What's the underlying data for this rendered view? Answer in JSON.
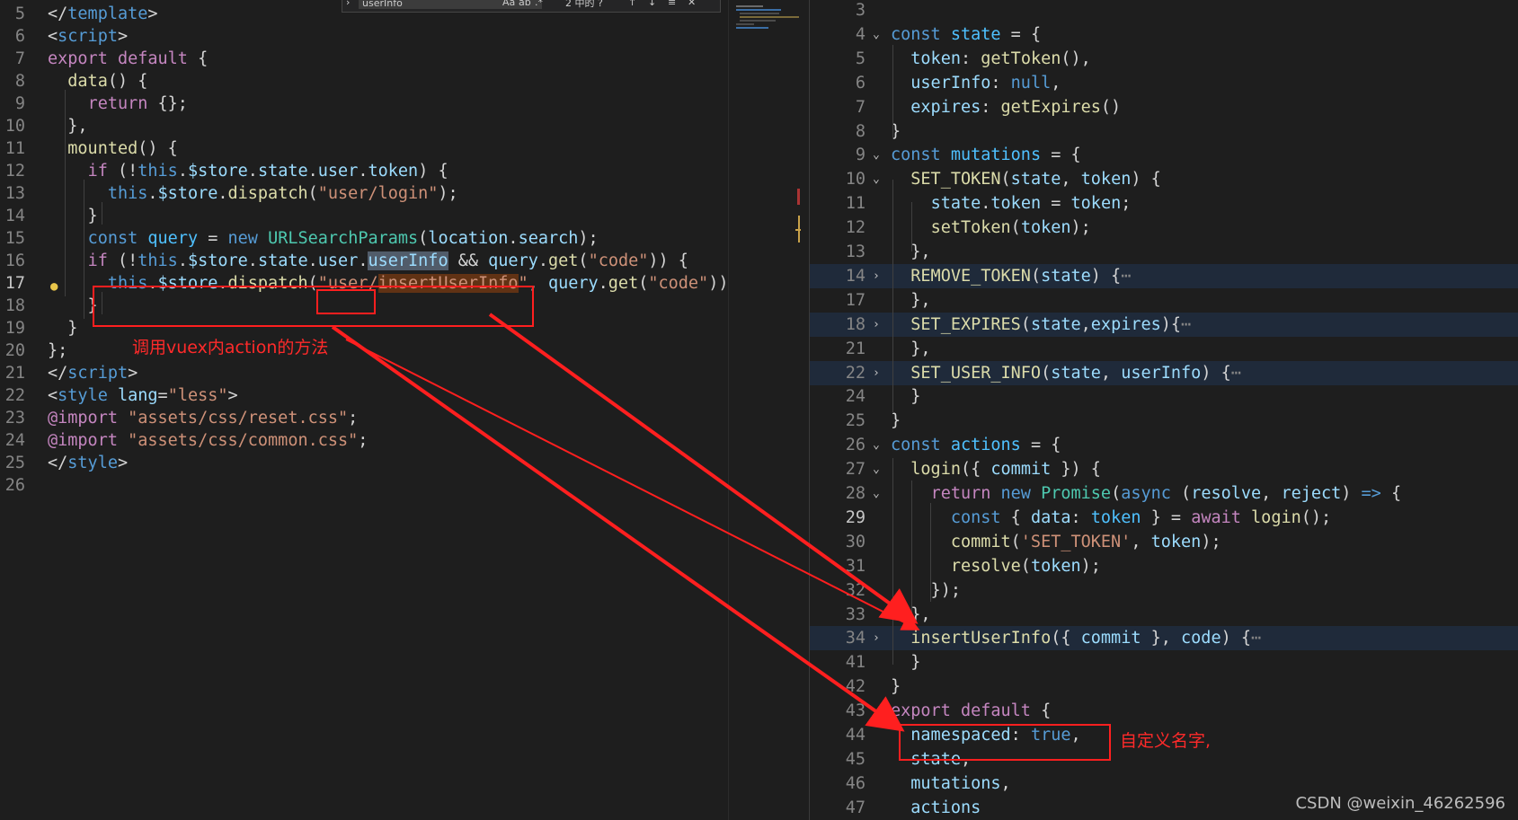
{
  "find_widget": {
    "query": "userInfo",
    "result": "2 中的 ?",
    "match_case": "Aa",
    "whole_word": "ab",
    "regex": ".*"
  },
  "left_editor": {
    "lines": [
      {
        "n": "5"
      },
      {
        "n": "6"
      },
      {
        "n": "7"
      },
      {
        "n": "8"
      },
      {
        "n": "9"
      },
      {
        "n": "10"
      },
      {
        "n": "11"
      },
      {
        "n": "12"
      },
      {
        "n": "13"
      },
      {
        "n": "14"
      },
      {
        "n": "15"
      },
      {
        "n": "16"
      },
      {
        "n": "17"
      },
      {
        "n": "18"
      },
      {
        "n": "19"
      },
      {
        "n": "20"
      },
      {
        "n": "21"
      },
      {
        "n": "22"
      },
      {
        "n": "23"
      },
      {
        "n": "24"
      },
      {
        "n": "25"
      },
      {
        "n": "26"
      }
    ],
    "code": {
      "template_close": "template",
      "script_open": "script",
      "export_default": "export default",
      "data_fn": "data",
      "return_kw": "return",
      "mounted_fn": "mounted",
      "if_kw": "if",
      "this_kw": "this",
      "store": "$store",
      "state": "state",
      "user": "user",
      "token": "token",
      "dispatch": "dispatch",
      "login_str": "\"user/login\"",
      "const_kw": "const",
      "query": "query",
      "new_kw": "new",
      "urlsp": "URLSearchParams",
      "location": "location",
      "search": "search",
      "userInfo": "userInfo",
      "get": "get",
      "code_str": "\"code\"",
      "insert_str_q": "\"",
      "insert_str_user": "user/",
      "insert_str_fn": "insertUserInfo",
      "script_close": "script",
      "style_open": "style",
      "lang_attr": "lang",
      "lang_val": "\"less\"",
      "import_kw": "@import",
      "reset_css": "\"assets/css/reset.css\"",
      "common_css": "\"assets/css/common.css\"",
      "style_close": "style"
    }
  },
  "right_editor": {
    "lines": [
      {
        "n": "3"
      },
      {
        "n": "4"
      },
      {
        "n": "5"
      },
      {
        "n": "6"
      },
      {
        "n": "7"
      },
      {
        "n": "8"
      },
      {
        "n": "9"
      },
      {
        "n": "10"
      },
      {
        "n": "11"
      },
      {
        "n": "12"
      },
      {
        "n": "13"
      },
      {
        "n": "14"
      },
      {
        "n": "17"
      },
      {
        "n": "18"
      },
      {
        "n": "21"
      },
      {
        "n": "22"
      },
      {
        "n": "24"
      },
      {
        "n": "25"
      },
      {
        "n": "26"
      },
      {
        "n": "27"
      },
      {
        "n": "28"
      },
      {
        "n": "29"
      },
      {
        "n": "30"
      },
      {
        "n": "31"
      },
      {
        "n": "32"
      },
      {
        "n": "33"
      },
      {
        "n": "34"
      },
      {
        "n": "41"
      },
      {
        "n": "42"
      },
      {
        "n": "43"
      },
      {
        "n": "44"
      },
      {
        "n": "45"
      },
      {
        "n": "46"
      },
      {
        "n": "47"
      }
    ],
    "code": {
      "const_kw": "const",
      "state": "state",
      "token": "token",
      "getToken": "getToken",
      "userInfo": "userInfo",
      "null_kw": "null",
      "expires": "expires",
      "getExpires": "getExpires",
      "mutations": "mutations",
      "set_token": "SET_TOKEN",
      "setToken": "setToken",
      "remove_token": "REMOVE_TOKEN",
      "set_expires": "SET_EXPIRES",
      "set_user_info": "SET_USER_INFO",
      "actions": "actions",
      "login": "login",
      "commit": "commit",
      "return_kw": "return",
      "new_kw": "new",
      "promise": "Promise",
      "async_kw": "async",
      "resolve": "resolve",
      "reject": "reject",
      "arrow": "=>",
      "data": "data",
      "await_kw": "await",
      "set_token_str": "'SET_TOKEN'",
      "insertUserInfo": "insertUserInfo",
      "code": "code",
      "export_default": "export default",
      "namespaced": "namespaced",
      "true_kw": "true",
      "ellipsis": "⋯"
    }
  },
  "annotations": {
    "left_note": "调用vuex内action的方法",
    "right_note": "自定义名字,"
  },
  "colors": {
    "annotation_red": "#ff1f1f",
    "background": "#1e1e1e"
  },
  "watermark": "CSDN @weixin_46262596"
}
